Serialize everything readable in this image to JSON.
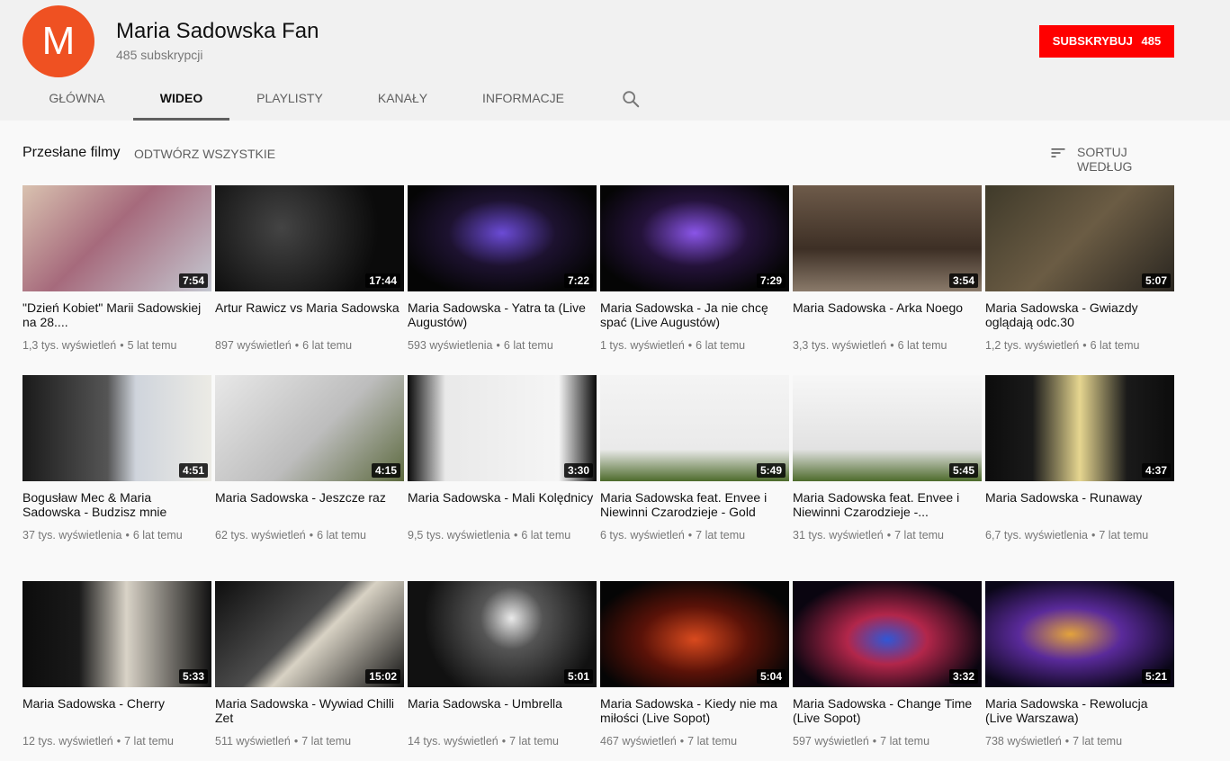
{
  "channel": {
    "avatar_letter": "M",
    "name": "Maria Sadowska Fan",
    "subscribers": "485 subskrypcji",
    "subscribe_label": "SUBSKRYBUJ",
    "subscribe_count": "485",
    "accent_color": "#ff0000",
    "avatar_color": "#ef5122"
  },
  "tabs": [
    "GŁÓWNA",
    "WIDEO",
    "PLAYLISTY",
    "KANAŁY",
    "INFORMACJE"
  ],
  "active_tab": "WIDEO",
  "section": {
    "title": "Przesłane filmy",
    "play_all": "ODTWÓRZ WSZYSTKIE",
    "sort_label": "SORTUJ WEDŁUG"
  },
  "videos": [
    {
      "title": "\"Dzień Kobiet\" Marii Sadowskiej na 28....",
      "views": "1,3 tys. wyświetleń",
      "age": "5 lat temu",
      "duration": "7:54"
    },
    {
      "title": "Artur Rawicz vs Maria Sadowska",
      "views": "897 wyświetleń",
      "age": "6 lat temu",
      "duration": "17:44"
    },
    {
      "title": "Maria Sadowska - Yatra ta (Live Augustów)",
      "views": "593 wyświetlenia",
      "age": "6 lat temu",
      "duration": "7:22"
    },
    {
      "title": "Maria Sadowska - Ja nie chcę spać (Live Augustów)",
      "views": "1 tys. wyświetleń",
      "age": "6 lat temu",
      "duration": "7:29"
    },
    {
      "title": "Maria Sadowska - Arka Noego",
      "views": "3,3 tys. wyświetleń",
      "age": "6 lat temu",
      "duration": "3:54"
    },
    {
      "title": "Maria Sadowska - Gwiazdy oglądają odc.30",
      "views": "1,2 tys. wyświetleń",
      "age": "6 lat temu",
      "duration": "5:07"
    },
    {
      "title": "Bogusław Mec & Maria Sadowska - Budzisz mnie",
      "views": "37 tys. wyświetlenia",
      "age": "6 lat temu",
      "duration": "4:51"
    },
    {
      "title": "Maria Sadowska - Jeszcze raz",
      "views": "62 tys. wyświetleń",
      "age": "6 lat temu",
      "duration": "4:15"
    },
    {
      "title": "Maria Sadowska - Mali Kolędnicy",
      "views": "9,5 tys. wyświetlenia",
      "age": "6 lat temu",
      "duration": "3:30"
    },
    {
      "title": "Maria Sadowska feat. Envee i Niewinni Czarodzieje - Gold",
      "views": "6 tys. wyświetleń",
      "age": "7 lat temu",
      "duration": "5:49"
    },
    {
      "title": "Maria Sadowska feat. Envee i Niewinni Czarodzieje -...",
      "views": "31 tys. wyświetleń",
      "age": "7 lat temu",
      "duration": "5:45"
    },
    {
      "title": "Maria Sadowska - Runaway",
      "views": "6,7 tys. wyświetlenia",
      "age": "7 lat temu",
      "duration": "4:37"
    },
    {
      "title": "Maria Sadowska - Cherry",
      "views": "12 tys. wyświetleń",
      "age": "7 lat temu",
      "duration": "5:33"
    },
    {
      "title": "Maria Sadowska - Wywiad Chilli Zet",
      "views": "511 wyświetleń",
      "age": "7 lat temu",
      "duration": "15:02"
    },
    {
      "title": "Maria Sadowska - Umbrella",
      "views": "14 tys. wyświetleń",
      "age": "7 lat temu",
      "duration": "5:01"
    },
    {
      "title": "Maria Sadowska - Kiedy nie ma miłości (Live Sopot)",
      "views": "467 wyświetleń",
      "age": "7 lat temu",
      "duration": "5:04"
    },
    {
      "title": "Maria Sadowska - Change Time (Live Sopot)",
      "views": "597 wyświetleń",
      "age": "7 lat temu",
      "duration": "3:32"
    },
    {
      "title": "Maria Sadowska - Rewolucja (Live Warszawa)",
      "views": "738 wyświetleń",
      "age": "7 lat temu",
      "duration": "5:21"
    }
  ]
}
